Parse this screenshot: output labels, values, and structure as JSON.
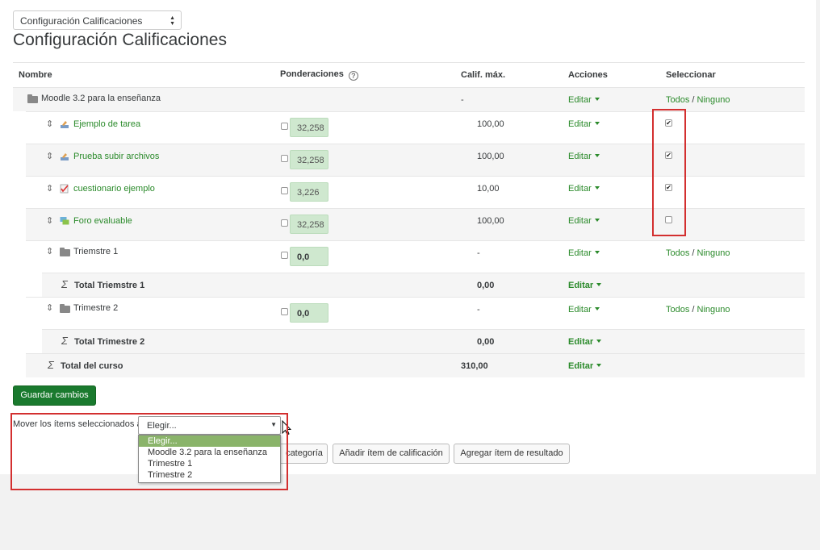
{
  "nav_select": {
    "value": "Configuración Calificaciones"
  },
  "page_title": "Configuración Calificaciones",
  "headers": {
    "name": "Nombre",
    "weights": "Ponderaciones",
    "max_grade": "Calif. máx.",
    "actions": "Acciones",
    "select": "Seleccionar"
  },
  "help_icon_glyph": "?",
  "rows": [
    {
      "name": "Moodle 3.2 para la enseñanza",
      "max": "-",
      "action": "Editar",
      "select": "Todos / Ninguno",
      "select_all": "Todos",
      "select_none": "Ninguno"
    },
    {
      "name": "Ejemplo de tarea",
      "weight": "32,258",
      "max": "100,00",
      "action": "Editar",
      "checked": true,
      "icon": "assignment-icon"
    },
    {
      "name": "Prueba subir archivos",
      "weight": "32,258",
      "max": "100,00",
      "action": "Editar",
      "checked": true,
      "icon": "assignment-icon"
    },
    {
      "name": "cuestionario ejemplo",
      "weight": "3,226",
      "max": "10,00",
      "action": "Editar",
      "checked": true,
      "icon": "quiz-icon"
    },
    {
      "name": "Foro evaluable",
      "weight": "32,258",
      "max": "100,00",
      "action": "Editar",
      "checked": false,
      "icon": "forum-icon"
    },
    {
      "name": "Triemstre 1",
      "weight": "0,0",
      "max": "-",
      "action": "Editar",
      "select_all": "Todos",
      "select_none": "Ninguno",
      "sep": "/"
    },
    {
      "name": "Total Triemstre 1",
      "max": "0,00",
      "action": "Editar"
    },
    {
      "name": "Trimestre 2",
      "weight": "0,0",
      "max": "-",
      "action": "Editar",
      "select_all": "Todos",
      "select_none": "Ninguno",
      "sep": "/"
    },
    {
      "name": "Total Trimestre 2",
      "max": "0,00",
      "action": "Editar"
    },
    {
      "name": "Total del curso",
      "max": "310,00",
      "action": "Editar"
    }
  ],
  "save_button": "Guardar cambios",
  "move_label": "Mover los ítems seleccionados a",
  "move_select": {
    "value": "Elegir...",
    "options": [
      "Elegir...",
      "Moodle 3.2 para la enseñanza",
      "Trimestre 1",
      "Trimestre 2"
    ]
  },
  "buttons": {
    "add_category": "categoría",
    "add_grade_item": "Añadir ítem de calificación",
    "add_outcome_item": "Agregar ítem de resultado"
  },
  "colors": {
    "link": "#2a8a2a",
    "primary_button": "#1a7a2e",
    "highlight_red": "#d32f2f",
    "weight_box": "#cfe8cf"
  }
}
